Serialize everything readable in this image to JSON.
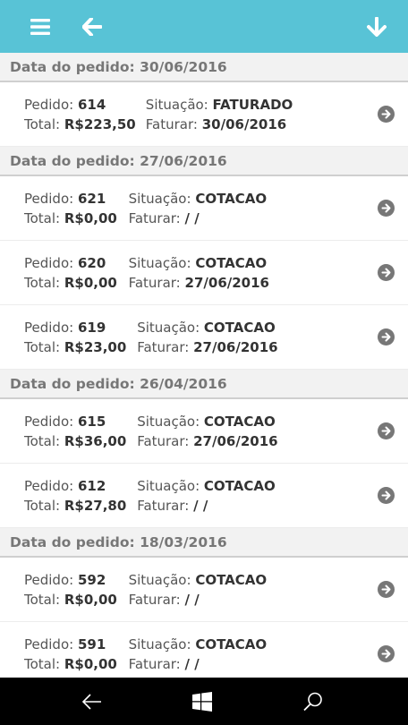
{
  "header": {
    "background": "#58c3d6",
    "icons": [
      "hamburger-menu-icon",
      "arrow-left-icon",
      "arrow-down-icon"
    ]
  },
  "labels": {
    "order": "Pedido:",
    "status": "Situação:",
    "total": "Total:",
    "invoice": "Faturar:"
  },
  "groups": [
    {
      "date_label": "Data do pedido: 30/06/2016",
      "orders": [
        {
          "number": "614",
          "status": "FATURADO",
          "total": "R$223,50",
          "invoice_date": "30/06/2016"
        }
      ]
    },
    {
      "date_label": "Data do pedido: 27/06/2016",
      "orders": [
        {
          "number": "621",
          "status": "COTACAO",
          "total": "R$0,00",
          "invoice_date": "/ /"
        },
        {
          "number": "620",
          "status": "COTACAO",
          "total": "R$0,00",
          "invoice_date": "27/06/2016"
        },
        {
          "number": "619",
          "status": "COTACAO",
          "total": "R$23,00",
          "invoice_date": "27/06/2016"
        }
      ]
    },
    {
      "date_label": "Data do pedido: 26/04/2016",
      "orders": [
        {
          "number": "615",
          "status": "COTACAO",
          "total": "R$36,00",
          "invoice_date": "27/06/2016"
        },
        {
          "number": "612",
          "status": "COTACAO",
          "total": "R$27,80",
          "invoice_date": "/ /"
        }
      ]
    },
    {
      "date_label": "Data do pedido: 18/03/2016",
      "orders": [
        {
          "number": "592",
          "status": "COTACAO",
          "total": "R$0,00",
          "invoice_date": "/ /"
        },
        {
          "number": "591",
          "status": "COTACAO",
          "total": "R$0,00",
          "invoice_date": "/ /"
        }
      ]
    }
  ],
  "navbar": {
    "icons": [
      "back-arrow-icon",
      "windows-logo-icon",
      "search-icon"
    ]
  }
}
